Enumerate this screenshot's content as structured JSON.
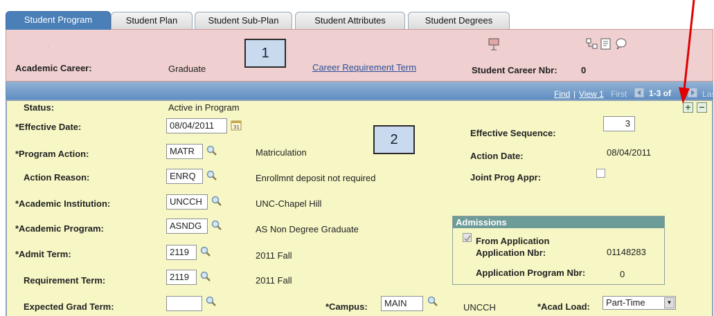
{
  "tabs": [
    {
      "label": "Student Program",
      "active": true
    },
    {
      "label": "Student Plan"
    },
    {
      "label": "Student Sub-Plan"
    },
    {
      "label": "Student Attributes"
    },
    {
      "label": "Student Degrees"
    }
  ],
  "header": {
    "academic_career_label": "Academic Career:",
    "academic_career_value": "Graduate",
    "callout_1": "1",
    "career_requirement_term_link": "Career Requirement Term",
    "student_career_nbr_label": "Student Career Nbr:",
    "student_career_nbr_value": "0"
  },
  "nav_bar": {
    "find": "Find",
    "separator": "|",
    "view": "View 1",
    "first": "First",
    "range": "1-3 of",
    "last": "Last"
  },
  "form": {
    "status_label": "Status:",
    "status_value": "Active in Program",
    "effective_date_label": "*Effective Date:",
    "effective_date_value": "08/04/2011",
    "callout_2": "2",
    "effective_sequence_label": "Effective Sequence:",
    "effective_sequence_value": "3",
    "program_action_label": "*Program Action:",
    "program_action_value": "MATR",
    "program_action_desc": "Matriculation",
    "action_date_label": "Action Date:",
    "action_date_value": "08/04/2011",
    "action_reason_label": "Action Reason:",
    "action_reason_value": "ENRQ",
    "action_reason_desc": "Enrollmnt deposit not required",
    "joint_prog_appr_label": "Joint Prog Appr:",
    "academic_institution_label": "*Academic Institution:",
    "academic_institution_value": "UNCCH",
    "academic_institution_desc": "UNC-Chapel Hill",
    "academic_program_label": "*Academic Program:",
    "academic_program_value": "ASNDG",
    "academic_program_desc": "AS Non Degree Graduate",
    "admit_term_label": "*Admit Term:",
    "admit_term_value": "2119",
    "admit_term_desc": "2011 Fall",
    "requirement_term_label": "Requirement Term:",
    "requirement_term_value": "2119",
    "requirement_term_desc": "2011 Fall",
    "expected_grad_term_label": "Expected Grad Term:",
    "expected_grad_term_value": "",
    "campus_label": "*Campus:",
    "campus_value": "MAIN",
    "campus_desc": "UNCCH",
    "acad_load_label": "*Acad Load:",
    "acad_load_value": "Part-Time"
  },
  "admissions": {
    "title": "Admissions",
    "from_application_label": "From Application",
    "application_nbr_label": "Application Nbr:",
    "application_nbr_value": "01148283",
    "application_program_nbr_label": "Application Program Nbr:",
    "application_program_nbr_value": "0"
  },
  "controls": {
    "plus": "+",
    "minus": "−"
  },
  "colors": {
    "header_bg": "#efcfcf",
    "panel_bg": "#f7f7c6",
    "tab_active": "#4a7fb8",
    "annotation_arrow": "#e00000"
  }
}
